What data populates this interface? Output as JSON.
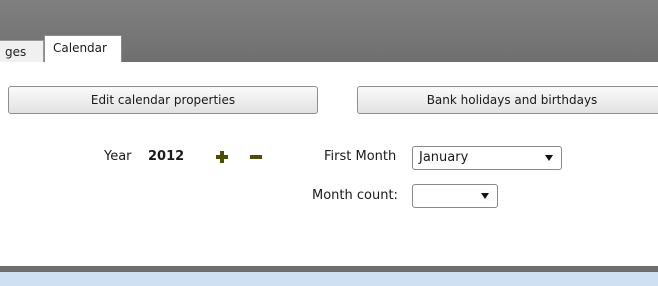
{
  "tabs": [
    {
      "label": "ges"
    },
    {
      "label": "Calendar"
    }
  ],
  "toolbar": {
    "edit_calendar_label": "Edit calendar properties",
    "bank_holidays_label": "Bank holidays and birthdays"
  },
  "year": {
    "label": "Year",
    "value": "2012",
    "increment_icon": "plus-icon",
    "decrement_icon": "minus-icon",
    "icon_color": "#4e4e00"
  },
  "first_month": {
    "label": "First Month",
    "selected": "January"
  },
  "month_count": {
    "label": "Month count:",
    "selected": ""
  },
  "colors": {
    "tab_bar": "#777777",
    "bottom_strip": "#cfe0f2"
  }
}
